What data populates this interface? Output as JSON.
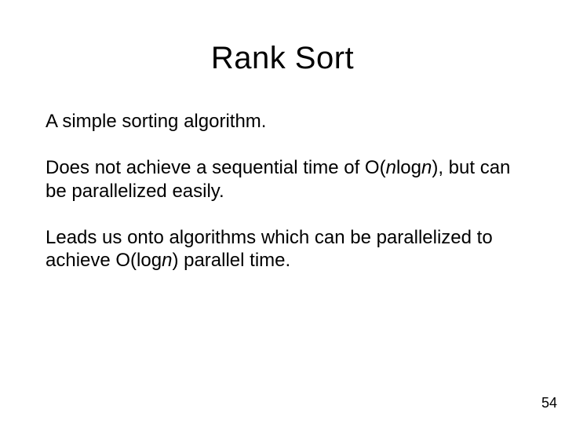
{
  "slide": {
    "title": "Rank Sort",
    "paragraphs": {
      "p1": "A simple sorting algorithm.",
      "p2a": "Does not achieve a sequential time of O(",
      "p2n1": "n",
      "p2b": "log",
      "p2n2": "n",
      "p2c": "), but can be parallelized easily.",
      "p3a": "Leads us onto algorithms which can be parallelized to achieve O(log",
      "p3n": "n",
      "p3b": ") parallel time."
    },
    "page_number": "54"
  }
}
